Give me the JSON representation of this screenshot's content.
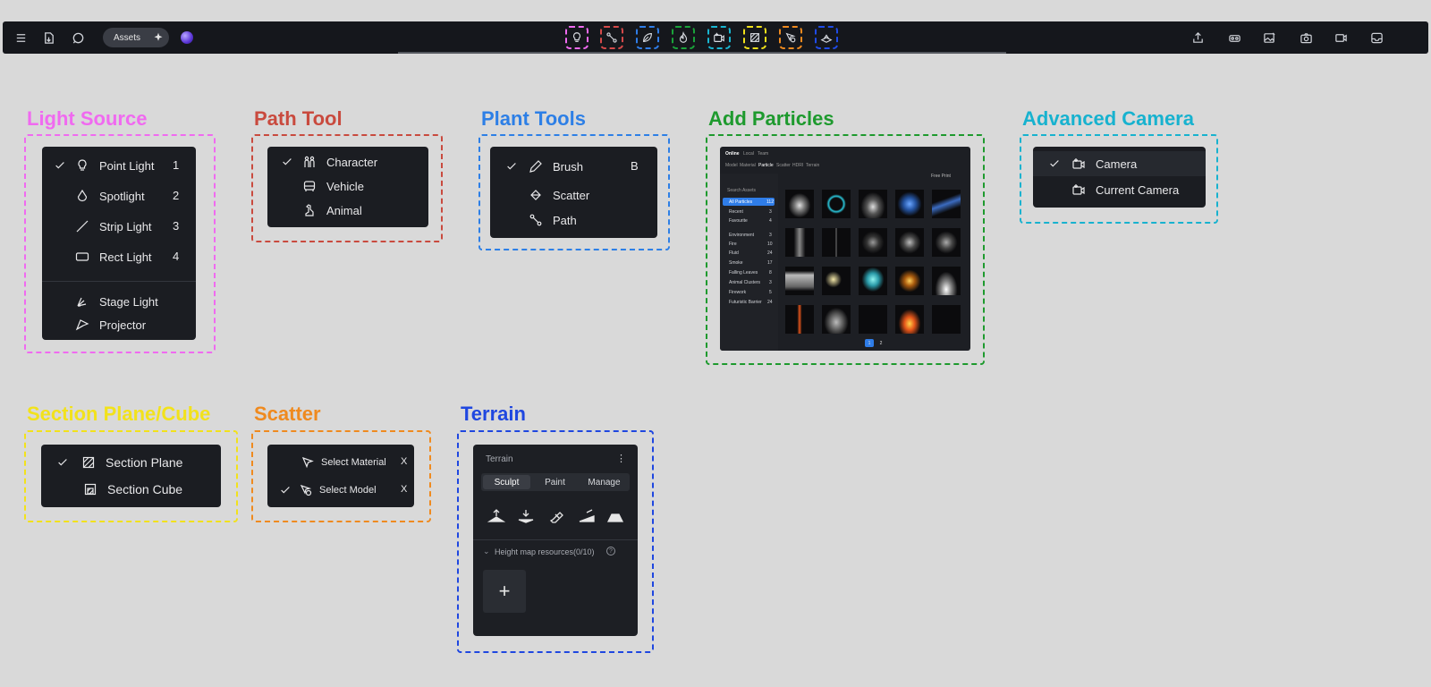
{
  "toolbar": {
    "assets_label": "Assets",
    "left_icons": [
      "menu-icon",
      "file-import-icon",
      "chat-icon"
    ],
    "tools": [
      {
        "name": "light-source-tool",
        "color": "#f06af0"
      },
      {
        "name": "path-tool",
        "color": "#d64a4a"
      },
      {
        "name": "plant-tool",
        "color": "#2f7de8"
      },
      {
        "name": "particles-tool",
        "color": "#1aa33a"
      },
      {
        "name": "advanced-camera-tool",
        "color": "#19b6d1"
      },
      {
        "name": "section-tool",
        "color": "#f2e11a"
      },
      {
        "name": "scatter-tool",
        "color": "#ef8a1f"
      },
      {
        "name": "terrain-tool",
        "color": "#1f4be8"
      }
    ],
    "right_icons": [
      "upload-icon",
      "vr-icon",
      "image-edit-icon",
      "camera-icon",
      "video-icon",
      "inbox-icon"
    ]
  },
  "light_source": {
    "title": "Light Source",
    "color": "#f06af0",
    "items": [
      {
        "label": "Point Light",
        "key": "1",
        "checked": true
      },
      {
        "label": "Spotlight",
        "key": "2"
      },
      {
        "label": "Strip Light",
        "key": "3"
      },
      {
        "label": "Rect Light",
        "key": "4"
      },
      {
        "label": "Stage Light"
      },
      {
        "label": "Projector"
      }
    ]
  },
  "path_tool": {
    "title": "Path Tool",
    "color": "#c94a3e",
    "items": [
      {
        "label": "Character",
        "checked": true
      },
      {
        "label": "Vehicle"
      },
      {
        "label": "Animal"
      }
    ]
  },
  "plant_tools": {
    "title": "Plant Tools",
    "color": "#2d7fe6",
    "items": [
      {
        "label": "Brush",
        "key": "B",
        "checked": true
      },
      {
        "label": "Scatter"
      },
      {
        "label": "Path"
      }
    ]
  },
  "add_particles": {
    "title": "Add Particles",
    "color": "#1e9a2e",
    "tabs": [
      "Online",
      "Local",
      "Team"
    ],
    "subtabs": [
      "Model",
      "Material",
      "Particle",
      "Scatter",
      "HDRI",
      "Terrain"
    ],
    "search_placeholder": "Search Assets",
    "filter_label": "Free Print",
    "categories": [
      {
        "label": "All Particles",
        "count": "112"
      },
      {
        "label": "Recent",
        "count": "3"
      },
      {
        "label": "Favourite",
        "count": "4"
      },
      {
        "label": "Environment",
        "count": "3"
      },
      {
        "label": "Fire",
        "count": "10"
      },
      {
        "label": "Fluid",
        "count": "24"
      },
      {
        "label": "Smoke",
        "count": "17"
      },
      {
        "label": "Falling Leaves",
        "count": "8"
      },
      {
        "label": "Animal Clusters",
        "count": "3"
      },
      {
        "label": "Firework",
        "count": "5"
      },
      {
        "label": "Futuristic Barrier",
        "count": "24"
      }
    ],
    "pages": [
      "1",
      "2"
    ]
  },
  "advanced_camera": {
    "title": "Advanced Camera",
    "color": "#17b2cf",
    "items": [
      {
        "label": "Camera",
        "checked": true
      },
      {
        "label": "Current Camera"
      }
    ]
  },
  "section": {
    "title": "Section Plane/Cube",
    "color": "#f2e21b",
    "items": [
      {
        "label": "Section Plane",
        "checked": true
      },
      {
        "label": "Section Cube"
      }
    ]
  },
  "scatter": {
    "title": "Scatter",
    "color": "#ef8a1f",
    "items": [
      {
        "label": "Select Material",
        "key": "X"
      },
      {
        "label": "Select Model",
        "key": "X",
        "checked": true
      }
    ]
  },
  "terrain": {
    "title": "Terrain",
    "color": "#1f47e0",
    "panel_title": "Terrain",
    "tabs": [
      "Sculpt",
      "Paint",
      "Manage"
    ],
    "section_label": "Height map resources(0/10)",
    "add_label": "+"
  }
}
